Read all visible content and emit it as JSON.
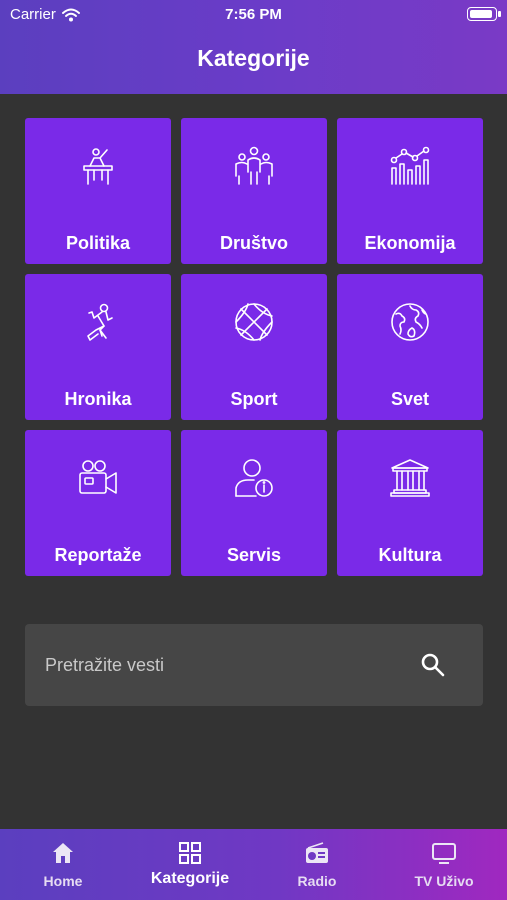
{
  "status_bar": {
    "carrier": "Carrier",
    "time": "7:56 PM"
  },
  "header": {
    "title": "Kategorije"
  },
  "categories": [
    {
      "label": "Politika",
      "icon": "podium-speaker-icon"
    },
    {
      "label": "Društvo",
      "icon": "people-group-icon"
    },
    {
      "label": "Ekonomija",
      "icon": "bar-chart-trend-icon"
    },
    {
      "label": "Hronika",
      "icon": "crime-scene-body-icon"
    },
    {
      "label": "Sport",
      "icon": "basketball-icon"
    },
    {
      "label": "Svet",
      "icon": "globe-icon"
    },
    {
      "label": "Reportaže",
      "icon": "video-camera-icon"
    },
    {
      "label": "Servis",
      "icon": "user-info-icon"
    },
    {
      "label": "Kultura",
      "icon": "museum-icon"
    }
  ],
  "search": {
    "placeholder": "Pretražite vesti",
    "value": ""
  },
  "tabbar": {
    "active": "Kategorije",
    "items": [
      {
        "label": "Home",
        "icon": "home-icon"
      },
      {
        "label": "Kategorije",
        "icon": "grid-icon"
      },
      {
        "label": "Radio",
        "icon": "radio-icon"
      },
      {
        "label": "TV Uživo",
        "icon": "tv-icon"
      }
    ]
  },
  "colors": {
    "header_gradient_start": "#5b3fbf",
    "tile": "#7a2ae8",
    "background": "#333333",
    "search_background": "#464646"
  }
}
